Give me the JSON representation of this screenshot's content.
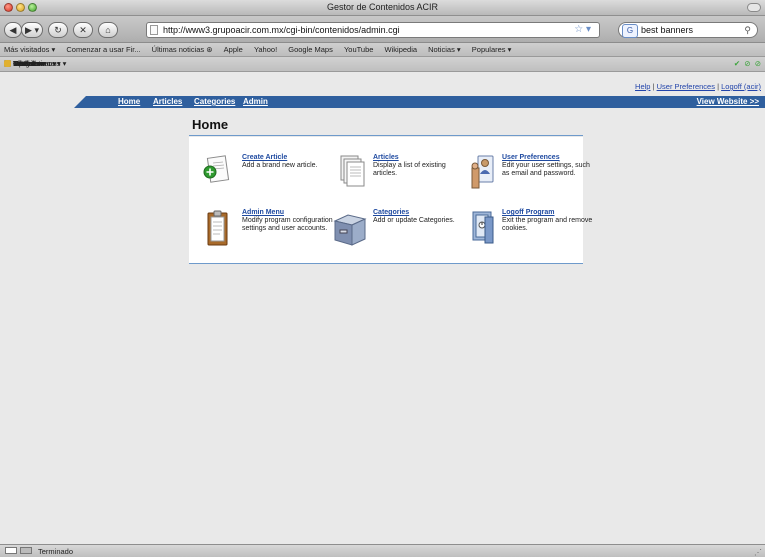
{
  "window": {
    "title": "Gestor de Contenidos ACIR"
  },
  "toolbar": {
    "url": "http://www3.grupoacir.com.mx/cgi-bin/contenidos/admin.cgi",
    "search_value": "best banners",
    "search_engine_label": "G"
  },
  "bookmarks": {
    "items": [
      "Más visitados ▾",
      "Comenzar a usar Fir...",
      "Últimas noticias ⊛",
      "Apple",
      "Yahoo!",
      "Google Maps",
      "YouTube",
      "Wikipedia",
      "Noticias ▾",
      "Populares ▾"
    ]
  },
  "devbar": {
    "items": [
      {
        "label": "Disable ▾",
        "color": "#d04545"
      },
      {
        "label": "Cookies ▾",
        "color": "#c8a25a"
      },
      {
        "label": "CSS ▾",
        "color": "#4a7ac8"
      },
      {
        "label": "Forms ▾",
        "color": "#9a9a9a"
      },
      {
        "label": "Images ▾",
        "color": "#6ab04a"
      },
      {
        "label": "Information ▾",
        "color": "#4a90d8"
      },
      {
        "label": "Miscellaneous ▾",
        "color": "#7a7a7a"
      },
      {
        "label": "Outline ▾",
        "color": "#e0b030"
      },
      {
        "label": "Resize ▾",
        "color": "#9a9a9a"
      },
      {
        "label": "Tools ▾",
        "color": "#c06030"
      },
      {
        "label": "View Source ▾",
        "color": "#4a7ac8"
      },
      {
        "label": "Options ▾",
        "color": "#e0b030"
      }
    ]
  },
  "toplinks": {
    "help": "Help",
    "sep": "|",
    "prefs": "User Preferences",
    "logoff": "Logoff (acir)"
  },
  "navbar": {
    "home": "Home",
    "articles": "Articles",
    "categories": "Categories",
    "admin": "Admin",
    "view_website": "View Website >>"
  },
  "main": {
    "title": "Home",
    "items": [
      {
        "title": "Create Article",
        "desc": "Add a brand new article.",
        "icon": "create-article-icon"
      },
      {
        "title": "Articles",
        "desc": "Display a list of existing articles.",
        "icon": "articles-icon"
      },
      {
        "title": "User Preferences",
        "desc": "Edit your user settings, such as email and password.",
        "icon": "user-preferences-icon"
      },
      {
        "title": "Admin Menu",
        "desc": "Modify program configuration settings and user accounts.",
        "icon": "admin-menu-icon"
      },
      {
        "title": "Categories",
        "desc": "Add or update Categories.",
        "icon": "categories-icon"
      },
      {
        "title": "Logoff Program",
        "desc": "Exit the program and remove cookies.",
        "icon": "logoff-icon"
      }
    ]
  },
  "status": {
    "text": "Terminado"
  }
}
